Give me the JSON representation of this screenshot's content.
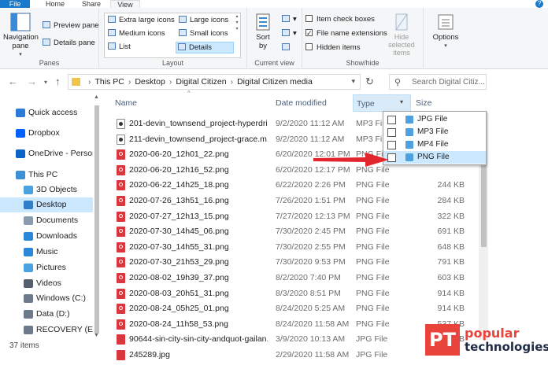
{
  "tabs": {
    "file": "File",
    "home": "Home",
    "share": "Share",
    "view": "View"
  },
  "ribbon": {
    "panes": {
      "navigation_pane": "Navigation pane",
      "preview_pane": "Preview pane",
      "details_pane": "Details pane",
      "group_label": "Panes"
    },
    "layout": {
      "items": [
        "Extra large icons",
        "Large icons",
        "Medium icons",
        "Small icons",
        "List",
        "Details"
      ],
      "selected": "Details",
      "group_label": "Layout"
    },
    "current_view": {
      "sort_by": "Sort by",
      "group_label": "Current view"
    },
    "show_hide": {
      "item_check_boxes": "Item check boxes",
      "item_check_boxes_checked": false,
      "file_name_extensions": "File name extensions",
      "file_name_extensions_checked": true,
      "hidden_items": "Hidden items",
      "hidden_items_checked": false,
      "hide_selected_items": "Hide selected items",
      "group_label": "Show/hide"
    },
    "options": "Options"
  },
  "address": {
    "breadcrumbs": [
      "This PC",
      "Desktop",
      "Digital Citizen",
      "Digital Citizen media"
    ],
    "search_placeholder": "Search Digital Citiz..."
  },
  "nav_pane": {
    "items": [
      {
        "label": "Quick access",
        "icon": "star-icon",
        "color": "#2b79d8"
      },
      {
        "label": "Dropbox",
        "icon": "dropbox-icon",
        "color": "#0061ff"
      },
      {
        "label": "OneDrive - Person",
        "icon": "cloud-icon",
        "color": "#0a64c8"
      },
      {
        "label": "This PC",
        "icon": "computer-icon",
        "color": "#3d8fd6"
      },
      {
        "label": "3D Objects",
        "icon": "cube-icon",
        "color": "#4aa3e0"
      },
      {
        "label": "Desktop",
        "icon": "desktop-icon",
        "color": "#2f7fc8",
        "selected": true
      },
      {
        "label": "Documents",
        "icon": "document-icon",
        "color": "#8a9bb0"
      },
      {
        "label": "Downloads",
        "icon": "download-icon",
        "color": "#2a88d8"
      },
      {
        "label": "Music",
        "icon": "music-icon",
        "color": "#2a88d8"
      },
      {
        "label": "Pictures",
        "icon": "picture-icon",
        "color": "#4aa3e0"
      },
      {
        "label": "Videos",
        "icon": "video-icon",
        "color": "#555f6e"
      },
      {
        "label": "Windows (C:)",
        "icon": "drive-icon",
        "color": "#6c7a8c"
      },
      {
        "label": "Data (D:)",
        "icon": "drive-icon",
        "color": "#6c7a8c"
      },
      {
        "label": "RECOVERY (E:)",
        "icon": "drive-icon",
        "color": "#6c7a8c"
      }
    ]
  },
  "columns": {
    "name": "Name",
    "date_modified": "Date modified",
    "type": "Type",
    "size": "Size"
  },
  "files": [
    {
      "name": "201-devin_townsend_project-hyperdri...",
      "date": "9/2/2020 11:12 AM",
      "type": "MP3 File",
      "size": "",
      "kind": "mp3"
    },
    {
      "name": "211-devin_townsend_project-grace.m...",
      "date": "9/2/2020 11:12 AM",
      "type": "MP3 File",
      "size": "",
      "kind": "mp3"
    },
    {
      "name": "2020-06-20_12h01_22.png",
      "date": "6/20/2020 12:01 PM",
      "type": "PNG File",
      "size": "",
      "kind": "png"
    },
    {
      "name": "2020-06-20_12h16_52.png",
      "date": "6/20/2020 12:17 PM",
      "type": "PNG File",
      "size": "",
      "kind": "png"
    },
    {
      "name": "2020-06-22_14h25_18.png",
      "date": "6/22/2020 2:26 PM",
      "type": "PNG File",
      "size": "244 KB",
      "kind": "png"
    },
    {
      "name": "2020-07-26_13h51_16.png",
      "date": "7/26/2020 1:51 PM",
      "type": "PNG File",
      "size": "284 KB",
      "kind": "png"
    },
    {
      "name": "2020-07-27_12h13_15.png",
      "date": "7/27/2020 12:13 PM",
      "type": "PNG File",
      "size": "322 KB",
      "kind": "png"
    },
    {
      "name": "2020-07-30_14h45_06.png",
      "date": "7/30/2020 2:45 PM",
      "type": "PNG File",
      "size": "691 KB",
      "kind": "png"
    },
    {
      "name": "2020-07-30_14h55_31.png",
      "date": "7/30/2020 2:55 PM",
      "type": "PNG File",
      "size": "648 KB",
      "kind": "png"
    },
    {
      "name": "2020-07-30_21h53_29.png",
      "date": "7/30/2020 9:53 PM",
      "type": "PNG File",
      "size": "791 KB",
      "kind": "png"
    },
    {
      "name": "2020-08-02_19h39_37.png",
      "date": "8/2/2020 7:40 PM",
      "type": "PNG File",
      "size": "603 KB",
      "kind": "png"
    },
    {
      "name": "2020-08-03_20h51_31.png",
      "date": "8/3/2020 8:51 PM",
      "type": "PNG File",
      "size": "914 KB",
      "kind": "png"
    },
    {
      "name": "2020-08-24_05h25_01.png",
      "date": "8/24/2020 5:25 AM",
      "type": "PNG File",
      "size": "914 KB",
      "kind": "png"
    },
    {
      "name": "2020-08-24_11h58_53.png",
      "date": "8/24/2020 11:58 AM",
      "type": "PNG File",
      "size": "537 KB",
      "kind": "png"
    },
    {
      "name": "90644-sin-city-sin-city-andquot-gailan...",
      "date": "3/9/2020 10:13 AM",
      "type": "JPG File",
      "size": "871 KB",
      "kind": "jpg"
    },
    {
      "name": "245289.jpg",
      "date": "2/29/2020 11:58 AM",
      "type": "JPG File",
      "size": "",
      "kind": "jpg"
    }
  ],
  "type_filter": {
    "options": [
      {
        "label": "JPG File",
        "checked": false
      },
      {
        "label": "MP3 File",
        "checked": false
      },
      {
        "label": "MP4 File",
        "checked": false
      },
      {
        "label": "PNG File",
        "checked": false,
        "highlighted": true
      }
    ]
  },
  "status": {
    "item_count": "37 items"
  },
  "watermark": {
    "badge": "PT",
    "line1": "popular",
    "line2": "technologies"
  },
  "colors": {
    "accent": "#1979ca",
    "arrow": "#e3262e",
    "selection": "#cce8ff",
    "png_icon": "#d9363e"
  }
}
